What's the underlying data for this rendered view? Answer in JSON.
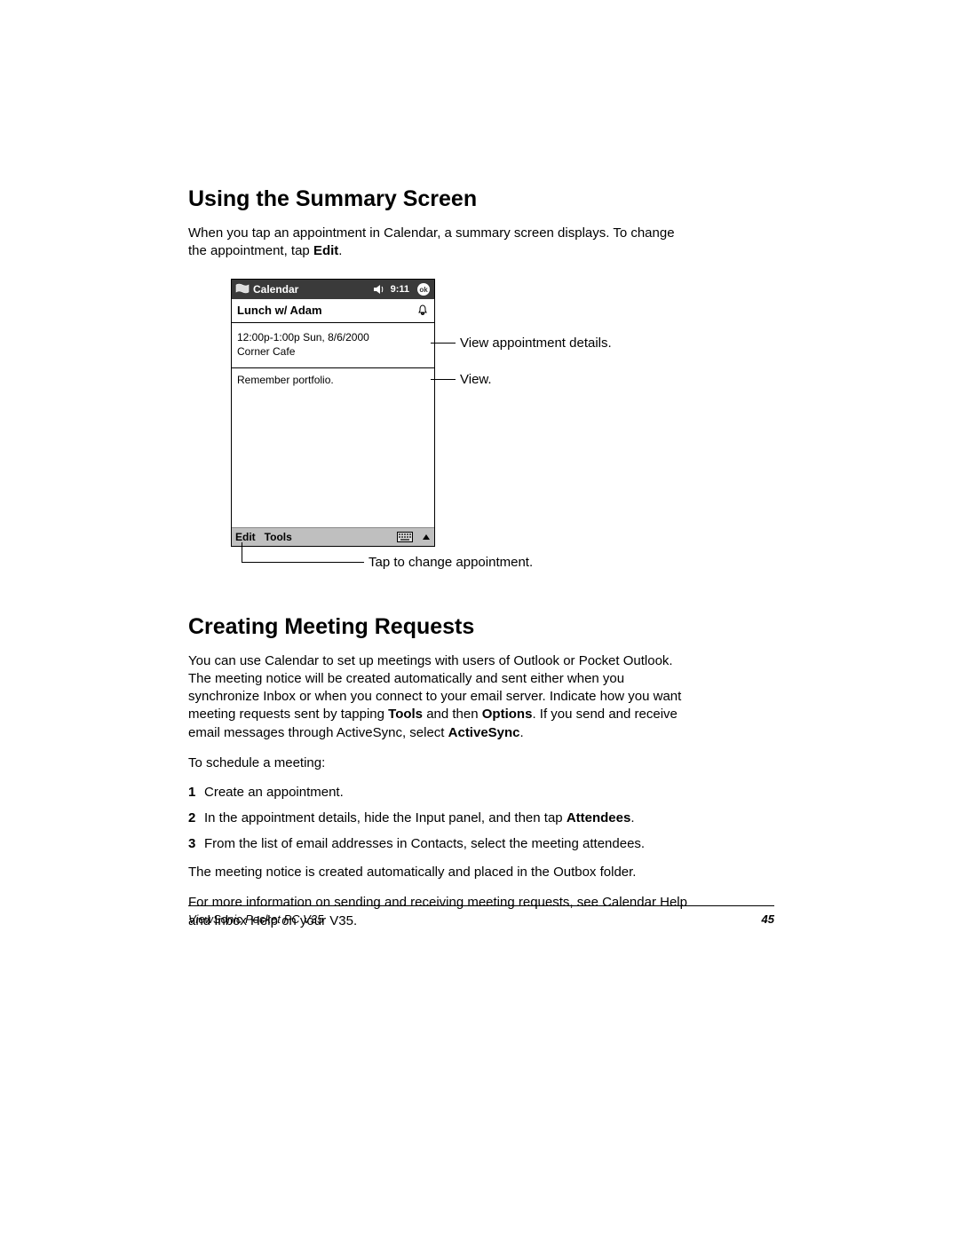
{
  "section1": {
    "heading": "Using the Summary Screen",
    "para_a": "When you tap an appointment in Calendar, a summary screen displays. To change the appointment, tap ",
    "para_b_bold": "Edit",
    "para_c": "."
  },
  "device": {
    "title": "Calendar",
    "time": "9:11",
    "subject": "Lunch w/ Adam",
    "details_line1": "12:00p-1:00p Sun, 8/6/2000",
    "details_line2": "Corner Cafe",
    "note": "Remember portfolio.",
    "cmd_edit": "Edit",
    "cmd_tools": "Tools"
  },
  "callouts": {
    "details": "View appointment details.",
    "view": "View.",
    "edit": "Tap to change appointment."
  },
  "section2": {
    "heading": "Creating Meeting Requests",
    "p1_a": "You can use Calendar to set up meetings with users of Outlook or Pocket Outlook. The meeting notice will be created automatically and sent either when you synchronize Inbox or when you connect to your email server. Indicate how you want meeting requests sent by tapping ",
    "p1_b": "Tools",
    "p1_c": " and then ",
    "p1_d": "Options",
    "p1_e": ". If you send and receive email messages through ActiveSync, select ",
    "p1_f": "ActiveSync",
    "p1_g": ".",
    "lead": "To schedule a meeting:",
    "steps": {
      "n1": "1",
      "s1": "Create an appointment.",
      "n2": "2",
      "s2a": "In the appointment details, hide the Input panel, and then tap ",
      "s2b": "Attendees",
      "s2c": ".",
      "n3": "3",
      "s3": "From the list of email addresses in Contacts, select the meeting attendees."
    },
    "p2": "The meeting notice is created automatically and placed in the Outbox folder.",
    "p3": "For more information on sending and receiving meeting requests, see Calendar Help and Inbox Help on your V35."
  },
  "footer": {
    "product": "ViewSonic Pocket PC  V35",
    "page": "45"
  }
}
